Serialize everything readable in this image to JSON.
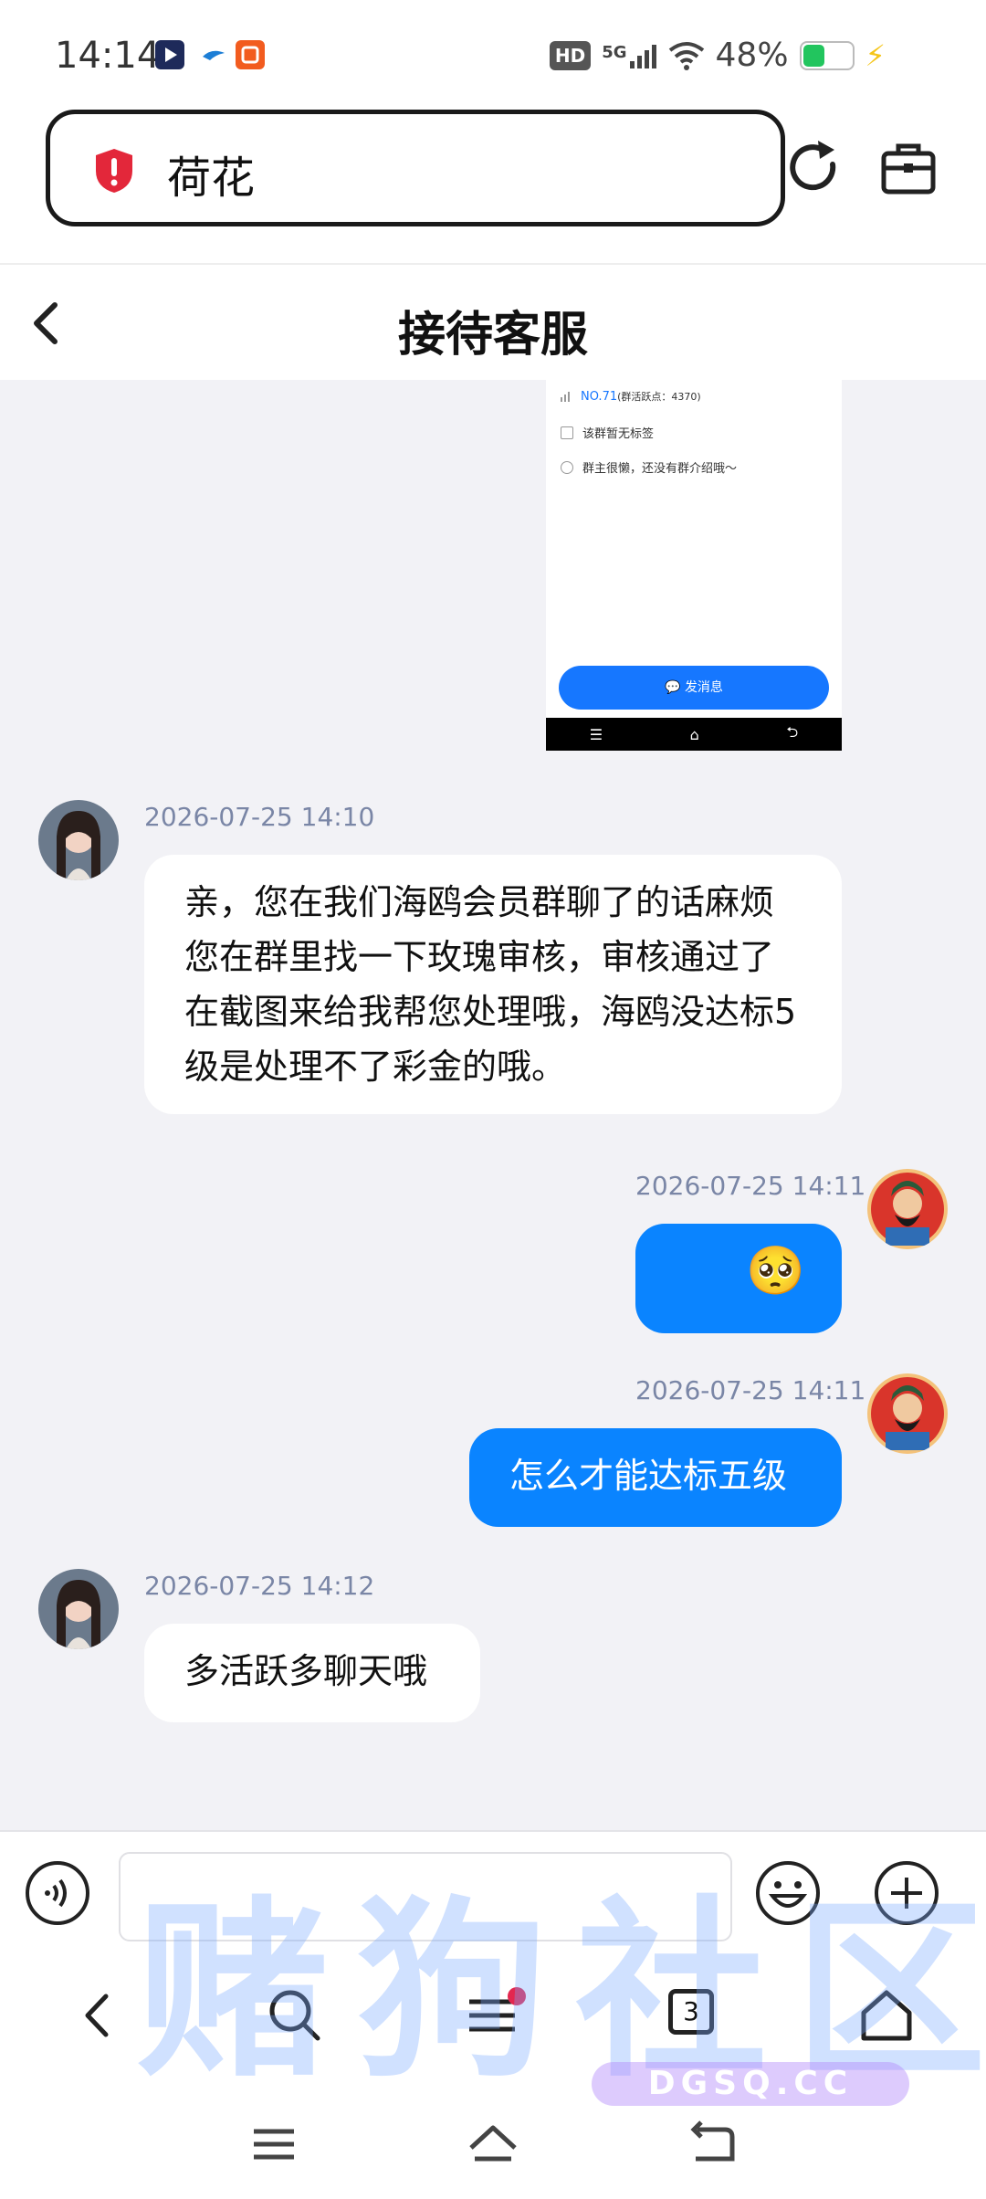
{
  "status_bar": {
    "time": "14:14",
    "hd": "HD",
    "network": "5G",
    "battery": "48%",
    "battery_level": 0.48,
    "icons": [
      "app-play-icon",
      "app-bird-icon",
      "app-orange-icon",
      "signal-icon",
      "wifi-icon",
      "battery-icon",
      "charging-bolt-icon"
    ]
  },
  "browser": {
    "address_text": "荷花",
    "icons": [
      "warning-shield-icon",
      "reload-icon",
      "toolbox-icon"
    ]
  },
  "header": {
    "title": "接待客服",
    "icon": "back-arrow-icon"
  },
  "shared_screenshot": {
    "line1_rank": "NO.71",
    "line1_rest": "(群活跃点：4370)",
    "line2": "该群暂无标签",
    "line3": "群主很懒，还没有群介绍哦～",
    "button": "发消息"
  },
  "messages": [
    {
      "side": "left",
      "time": "2026-07-25 14:10",
      "text": "亲，您在我们海鸥会员群聊了的话麻烦您在群里找一下玫瑰审核，审核通过了在截图来给我帮您处理哦，海鸥没达标5级是处理不了彩金的哦。"
    },
    {
      "side": "right",
      "time": "2026-07-25 14:11",
      "text": "🥺"
    },
    {
      "side": "right",
      "time": "2026-07-25 14:11",
      "text": "怎么才能达标五级"
    },
    {
      "side": "left",
      "time": "2026-07-25 14:12",
      "text": "多活跃多聊天哦"
    }
  ],
  "input_bar": {
    "placeholder": "",
    "icons": [
      "voice-icon",
      "emoji-icon",
      "plus-icon"
    ]
  },
  "toolbar": {
    "tab_count": "3",
    "icons": [
      "back-icon",
      "search-icon",
      "menu-icon",
      "tabs-icon",
      "home-icon"
    ]
  },
  "watermark": {
    "text": "赌狗社区",
    "sub": "DGSQ.CC"
  },
  "colors": {
    "accent": "#0a84ff",
    "chat_bg": "#f2f2f6",
    "timestamp": "#7a86a6",
    "warning": "#e3273a"
  }
}
